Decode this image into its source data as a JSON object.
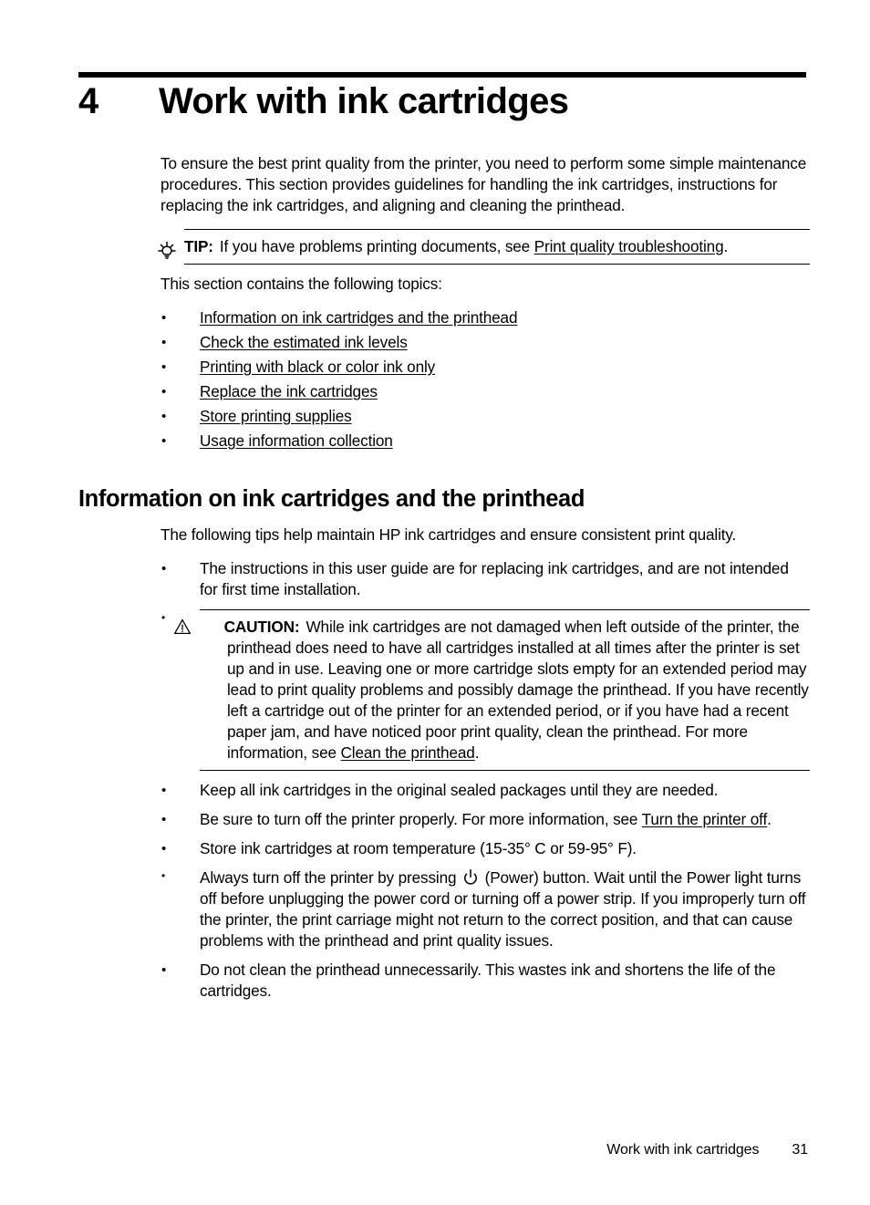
{
  "chapter": {
    "number": "4",
    "title": "Work with ink cartridges"
  },
  "intro": {
    "paragraph": "To ensure the best print quality from the printer, you need to perform some simple maintenance procedures. This section provides guidelines for handling the ink cartridges, instructions for replacing the ink cartridges, and aligning and cleaning the printhead."
  },
  "tip": {
    "icon": "lightbulb-icon",
    "label": "TIP:",
    "text_before": "If you have problems printing documents, see ",
    "link": "Print quality troubleshooting",
    "text_after": "."
  },
  "topics": {
    "lead_in": "This section contains the following topics:",
    "items": [
      "Information on ink cartridges and the printhead",
      "Check the estimated ink levels",
      "Printing with black or color ink only",
      "Replace the ink cartridges",
      "Store printing supplies",
      "Usage information collection"
    ]
  },
  "section": {
    "heading": "Information on ink cartridges and the printhead",
    "lead_in": "The following tips help maintain HP ink cartridges and ensure consistent print quality.",
    "bullet_1": "The instructions in this user guide are for replacing ink cartridges, and are not intended for first time installation.",
    "caution": {
      "icon": "warning-triangle-icon",
      "label": "CAUTION:",
      "text_before": "While ink cartridges are not damaged when left outside of the printer, the printhead does need to have all cartridges installed at all times after the printer is set up and in use. Leaving one or more cartridge slots empty for an extended period may lead to print quality problems and possibly damage the printhead. If you have recently left a cartridge out of the printer for an extended period, or if you have had a recent paper jam, and have noticed poor print quality, clean the printhead. For more information, see ",
      "link": "Clean the printhead",
      "text_after": "."
    },
    "bullet_keep": "Keep all ink cartridges in the original sealed packages until they are needed.",
    "bullet_turnoff": {
      "text_before": "Be sure to turn off the printer properly. For more information, see ",
      "link": "Turn the printer off",
      "text_after": "."
    },
    "bullet_store": "Store ink cartridges at room temperature (15-35° C or 59-95° F).",
    "bullet_power": {
      "text_before": "Always turn off the printer by pressing ",
      "icon": "power-icon",
      "text_after": " (Power) button. Wait until the Power light turns off before unplugging the power cord or turning off a power strip. If you improperly turn off the printer, the print carriage might not return to the correct position, and that can cause problems with the printhead and print quality issues."
    },
    "bullet_clean": "Do not clean the printhead unnecessarily. This wastes ink and shortens the life of the cartridges."
  },
  "footer": {
    "title": "Work with ink cartridges",
    "page_number": "31"
  }
}
